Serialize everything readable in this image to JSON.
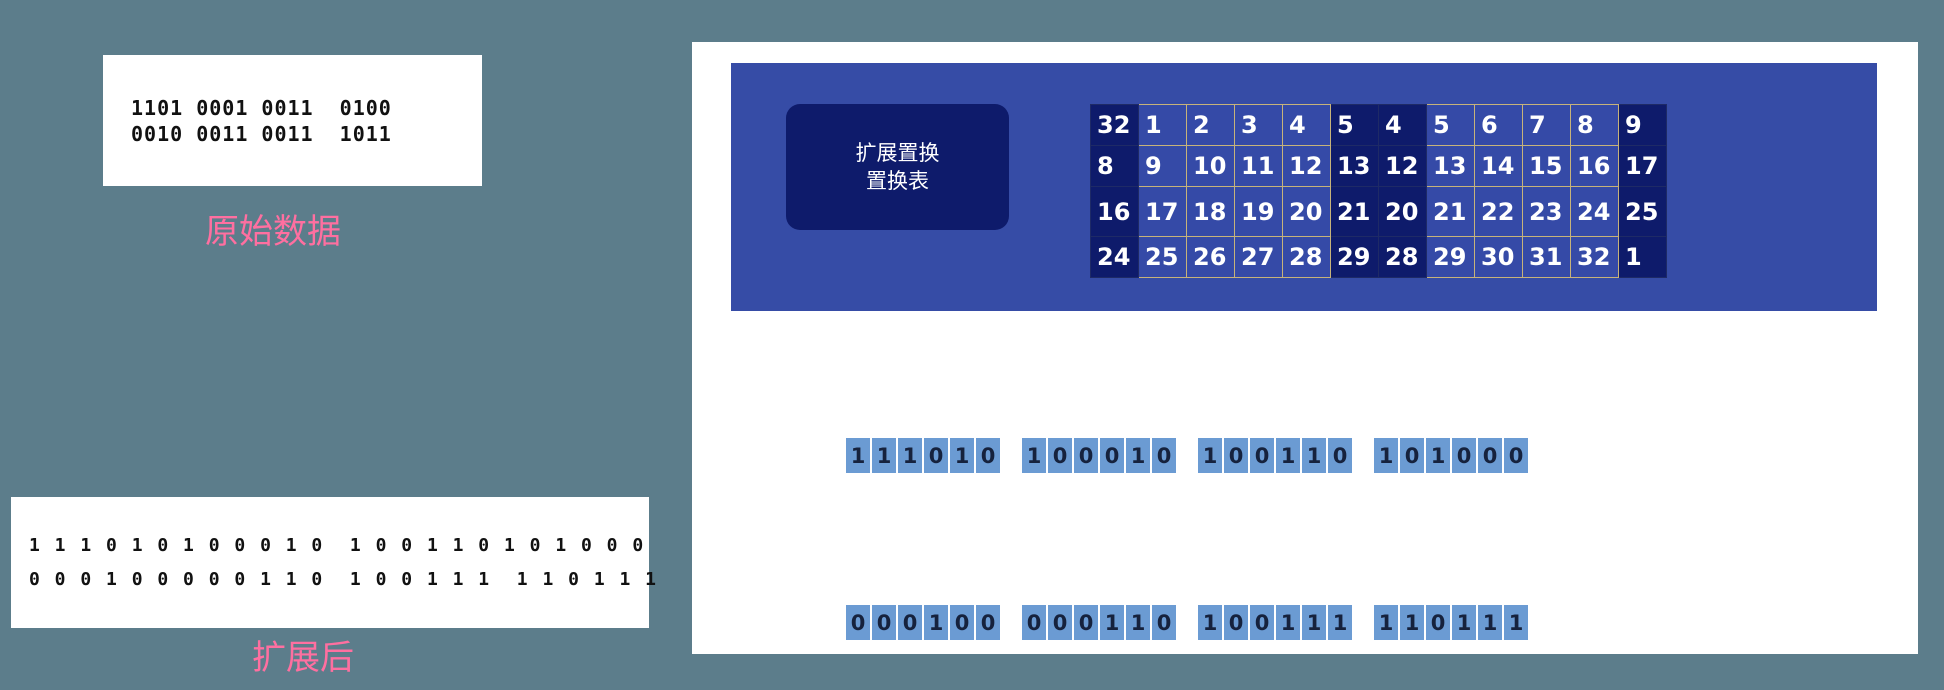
{
  "original": {
    "lines": [
      "1101 0001 0011  0100",
      "0010 0011 0011  1011"
    ],
    "caption": "原始数据"
  },
  "expanded": {
    "lines": [
      "1 1 1 0 1 0 1 0 0 0 1 0  1 0 0 1 1 0 1 0 1 0 0 0",
      "0 0 0 1 0 0 0 0 0 1 1 0  1 0 0 1 1 1  1 1 0 1 1 1"
    ],
    "caption": "扩展后"
  },
  "panel": {
    "label_line1": "扩展置换",
    "label_line2": "置换表",
    "table": [
      [
        "32",
        "1",
        "2",
        "3",
        "4",
        "5",
        "4",
        "5",
        "6",
        "7",
        "8",
        "9"
      ],
      [
        "8",
        "9",
        "10",
        "11",
        "12",
        "13",
        "12",
        "13",
        "14",
        "15",
        "16",
        "17"
      ],
      [
        "16",
        "17",
        "18",
        "19",
        "20",
        "21",
        "20",
        "21",
        "22",
        "23",
        "24",
        "25"
      ],
      [
        "24",
        "25",
        "26",
        "27",
        "28",
        "29",
        "28",
        "29",
        "30",
        "31",
        "32",
        "1"
      ]
    ],
    "bit_rows": [
      [
        [
          "1",
          "1",
          "1",
          "0",
          "1",
          "0"
        ],
        [
          "1",
          "0",
          "0",
          "0",
          "1",
          "0"
        ],
        [
          "1",
          "0",
          "0",
          "1",
          "1",
          "0"
        ],
        [
          "1",
          "0",
          "1",
          "0",
          "0",
          "0"
        ]
      ],
      [
        [
          "0",
          "0",
          "0",
          "1",
          "0",
          "0"
        ],
        [
          "0",
          "0",
          "0",
          "1",
          "1",
          "0"
        ],
        [
          "1",
          "0",
          "0",
          "1",
          "1",
          "1"
        ],
        [
          "1",
          "1",
          "0",
          "1",
          "1",
          "1"
        ]
      ]
    ]
  }
}
